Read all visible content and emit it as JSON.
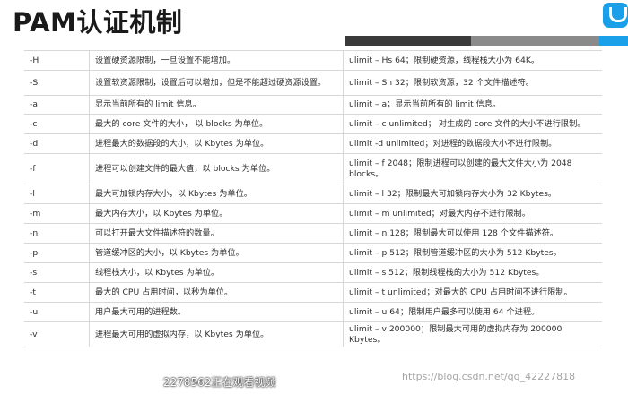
{
  "page": {
    "title": "PAM认证机制"
  },
  "table": {
    "rows": [
      {
        "option": "-H",
        "description": "设置硬资源限制，一旦设置不能增加。",
        "example": "ulimit – Hs 64；限制硬资源，线程栈大小为 64K。"
      },
      {
        "option": "-S",
        "description": "设置软资源限制，设置后可以增加，但是不能超过硬资源设置。",
        "example": "ulimit – Sn 32；限制软资源，32 个文件描述符。"
      },
      {
        "option": "-a",
        "description": "显示当前所有的 limit 信息。",
        "example": "ulimit – a；显示当前所有的 limit 信息。"
      },
      {
        "option": "-c",
        "description": "最大的 core 文件的大小， 以 blocks 为单位。",
        "example": "ulimit – c unlimited； 对生成的 core 文件的大小不进行限制。"
      },
      {
        "option": "-d",
        "description": "进程最大的数据段的大小，以 Kbytes 为单位。",
        "example": "ulimit -d unlimited；对进程的数据段大小不进行限制。"
      },
      {
        "option": "-f",
        "description": "进程可以创建文件的最大值，以 blocks 为单位。",
        "example": "ulimit – f 2048；限制进程可以创建的最大文件大小为 2048 blocks。"
      },
      {
        "option": "-l",
        "description": "最大可加锁内存大小，以 Kbytes 为单位。",
        "example": "ulimit – l 32；限制最大可加锁内存大小为 32 Kbytes。"
      },
      {
        "option": "-m",
        "description": "最大内存大小，以 Kbytes 为单位。",
        "example": "ulimit – m unlimited；对最大内存不进行限制。"
      },
      {
        "option": "-n",
        "description": "可以打开最大文件描述符的数量。",
        "example": "ulimit – n 128；限制最大可以使用 128 个文件描述符。"
      },
      {
        "option": "-p",
        "description": "管道缓冲区的大小，以 Kbytes 为单位。",
        "example": "ulimit – p 512；限制管道缓冲区的大小为 512 Kbytes。"
      },
      {
        "option": "-s",
        "description": "线程栈大小，以 Kbytes 为单位。",
        "example": "ulimit – s 512；限制线程栈的大小为 512 Kbytes。"
      },
      {
        "option": "-t",
        "description": "最大的 CPU 占用时间，以秒为单位。",
        "example": "ulimit – t unlimited；对最大的 CPU 占用时间不进行限制。"
      },
      {
        "option": "-u",
        "description": "用户最大可用的进程数。",
        "example": "ulimit – u 64；限制用户最多可以使用 64 个进程。"
      },
      {
        "option": "-v",
        "description": "进程最大可用的虚拟内存，以 Kbytes 为单位。",
        "example": "ulimit – v 200000；限制最大可用的虚拟内存为 200000 Kbytes。"
      }
    ]
  },
  "overlay": {
    "viewer_text": "2278562正在观看视频",
    "watermark": "https://blog.csdn.net/qq_42227818"
  },
  "colors": {
    "accent": "#1aa0e8",
    "bar_dark": "#3a3a3a",
    "bar_mid": "#8a8a8a"
  },
  "icons": {
    "logo": "brand-logo-icon"
  }
}
